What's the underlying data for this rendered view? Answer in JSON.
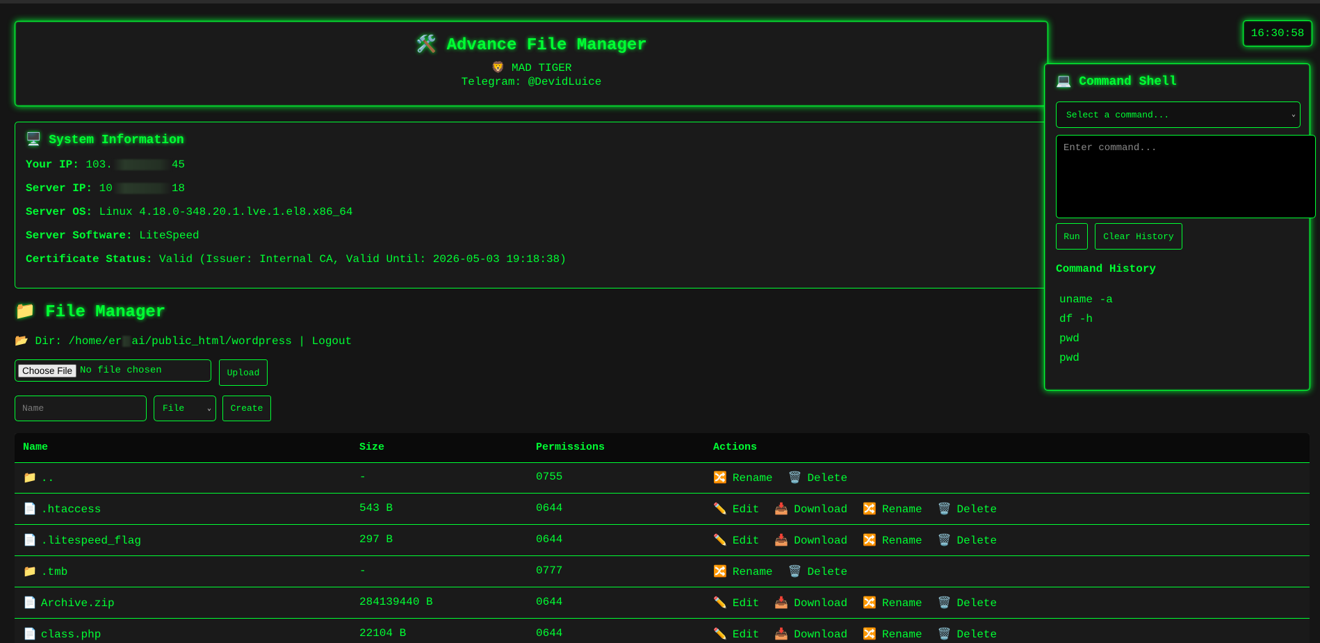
{
  "header": {
    "icon": "tools-icon",
    "title": "Advance File Manager",
    "subtitle": "MAD TIGER",
    "telegram": "Telegram: @DevidLuice"
  },
  "clock": "16:30:58",
  "sysinfo": {
    "title": "System Information",
    "rows": [
      {
        "label": "Your IP:",
        "value_start": "103.",
        "value_end": "45"
      },
      {
        "label": "Server IP:",
        "value_start": "10",
        "value_end": "18"
      },
      {
        "label": "Server OS:",
        "value": "Linux 4.18.0-348.20.1.lve.1.el8.x86_64"
      },
      {
        "label": "Server Software:",
        "value": "LiteSpeed"
      },
      {
        "label": "Certificate Status:",
        "value": "Valid (Issuer: Internal CA, Valid Until: 2026-05-03 19:18:38)"
      }
    ]
  },
  "file_manager": {
    "title": "File Manager",
    "dir_label": "Dir:",
    "dir_path_start": "/home/er",
    "dir_path_end": "ai/public_html/wordpress",
    "separator": "|",
    "logout": "Logout",
    "choose_file": "Choose File",
    "no_file": "No file chosen",
    "upload": "Upload",
    "name_placeholder": "Name",
    "type_selected": "File",
    "create": "Create"
  },
  "table": {
    "headers": [
      "Name",
      "Size",
      "Permissions",
      "Actions"
    ],
    "rows": [
      {
        "type": "folder",
        "name": "..",
        "size": "-",
        "perm": "0755",
        "actions": [
          "Rename",
          "Delete"
        ]
      },
      {
        "type": "file",
        "name": ".htaccess",
        "size": "543 B",
        "perm": "0644",
        "actions": [
          "Edit",
          "Download",
          "Rename",
          "Delete"
        ]
      },
      {
        "type": "file",
        "name": ".litespeed_flag",
        "size": "297 B",
        "perm": "0644",
        "actions": [
          "Edit",
          "Download",
          "Rename",
          "Delete"
        ]
      },
      {
        "type": "folder",
        "name": ".tmb",
        "size": "-",
        "perm": "0777",
        "actions": [
          "Rename",
          "Delete"
        ]
      },
      {
        "type": "file",
        "name": "Archive.zip",
        "size": "284139440 B",
        "perm": "0644",
        "actions": [
          "Edit",
          "Download",
          "Rename",
          "Delete"
        ]
      },
      {
        "type": "file",
        "name": "class.php",
        "size": "22104 B",
        "perm": "0644",
        "actions": [
          "Edit",
          "Download",
          "Rename",
          "Delete"
        ]
      }
    ]
  },
  "shell": {
    "title": "Command Shell",
    "select_placeholder": "Select a command...",
    "input_placeholder": "Enter command...",
    "run": "Run",
    "clear": "Clear History",
    "history_title": "Command History",
    "history": [
      "uname -a",
      "df -h",
      "pwd",
      "pwd"
    ]
  },
  "colors": {
    "accent": "#00ff33",
    "background": "#151515",
    "panel": "#1a1a1a"
  }
}
